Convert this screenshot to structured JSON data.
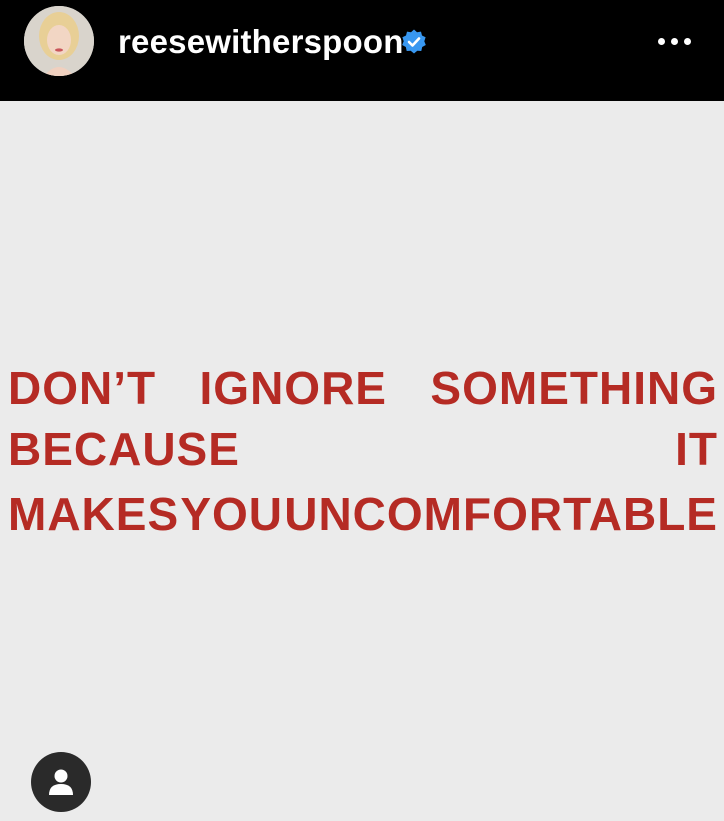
{
  "header": {
    "username": "reesewitherspoon",
    "verified": true,
    "colors": {
      "background": "#000000",
      "text": "#ffffff",
      "verified_badge": "#3897f0"
    },
    "icons": {
      "avatar": "profile-photo",
      "verified": "verified-badge-icon",
      "more": "more-options-icon"
    }
  },
  "post": {
    "background": "#ebebeb",
    "text_color": "#b52b24",
    "lines": [
      [
        "DON’T",
        "IGNORE",
        "SOMETHING"
      ],
      [
        "BECAUSE",
        "IT"
      ],
      [
        "MAKES",
        "YOU",
        "UNCOMFORTABLE"
      ]
    ],
    "tag_button": {
      "icon": "user-tag-icon"
    }
  }
}
